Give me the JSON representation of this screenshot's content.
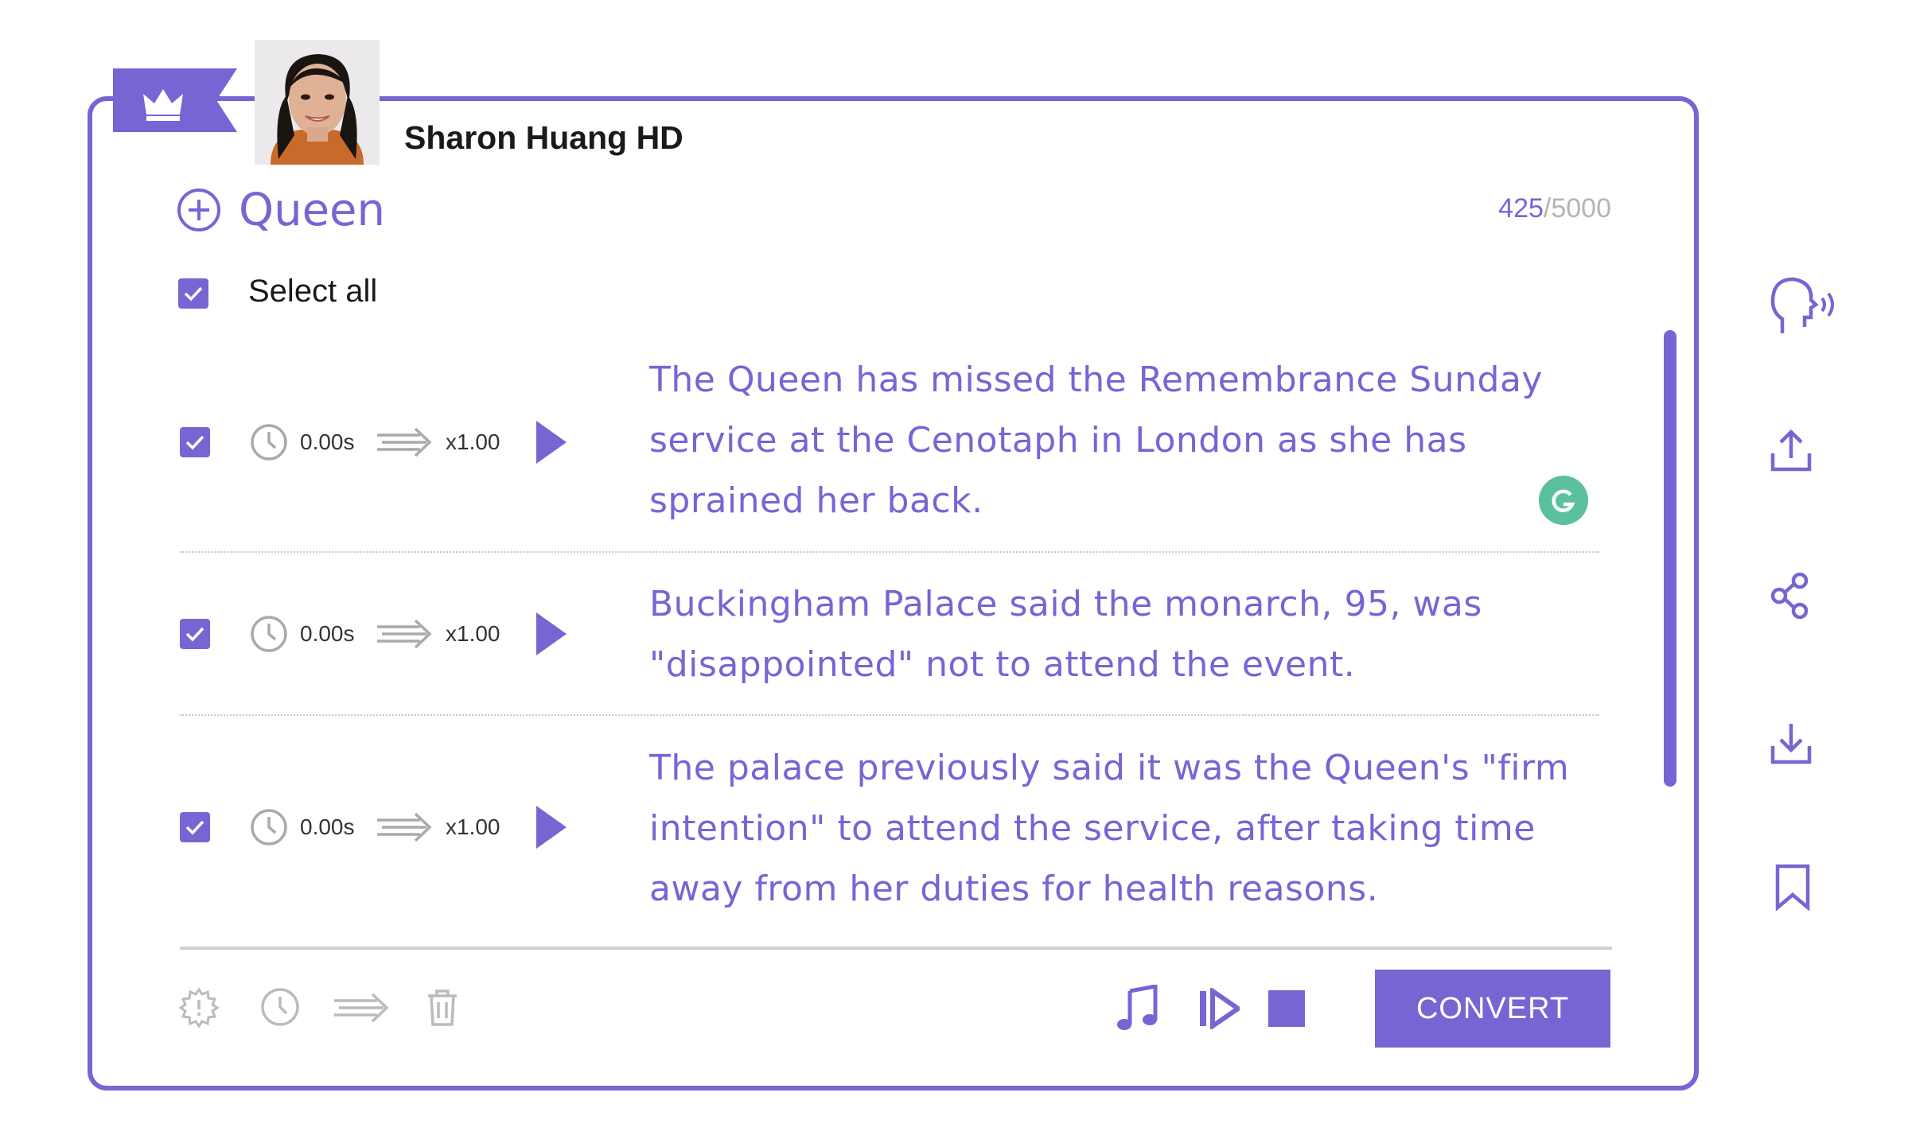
{
  "voice": {
    "name": "Sharon Huang HD"
  },
  "project": {
    "title": "Queen"
  },
  "char_count": {
    "current": "425",
    "separator": "/",
    "max": "5000"
  },
  "select_all": {
    "label": "Select all",
    "checked": true
  },
  "rows": [
    {
      "checked": true,
      "duration": "0.00s",
      "speed": "x1.00",
      "text": "The Queen has missed the Remembrance Sunday service at the Cenotaph in London as she has sprained her back."
    },
    {
      "checked": true,
      "duration": "0.00s",
      "speed": "x1.00",
      "text": "Buckingham Palace said the monarch, 95, was \"disappointed\" not to attend the event."
    },
    {
      "checked": true,
      "duration": "0.00s",
      "speed": "x1.00",
      "text": "The palace previously said it was the Queen's \"firm intention\" to attend the service, after taking time away from her duties for health reasons."
    }
  ],
  "footer": {
    "convert_label": "CONVERT"
  },
  "icons": {
    "premium": "crown-icon",
    "add": "plus-circle-icon",
    "row_pause": "clock-icon",
    "row_speed": "speed-arrow-icon",
    "row_play": "play-icon",
    "footer_tools": [
      "settings-gear-icon",
      "clock-icon",
      "speed-arrow-icon",
      "trash-icon"
    ],
    "footer_playback": [
      "music-note-icon",
      "play-from-icon",
      "stop-icon"
    ],
    "sidebar": [
      "voice-head-icon",
      "upload-icon",
      "share-icon",
      "download-icon",
      "bookmark-icon"
    ]
  },
  "colors": {
    "accent": "#7765d4",
    "muted": "#b4b4b4",
    "grammarly": "#5bc0a0"
  }
}
